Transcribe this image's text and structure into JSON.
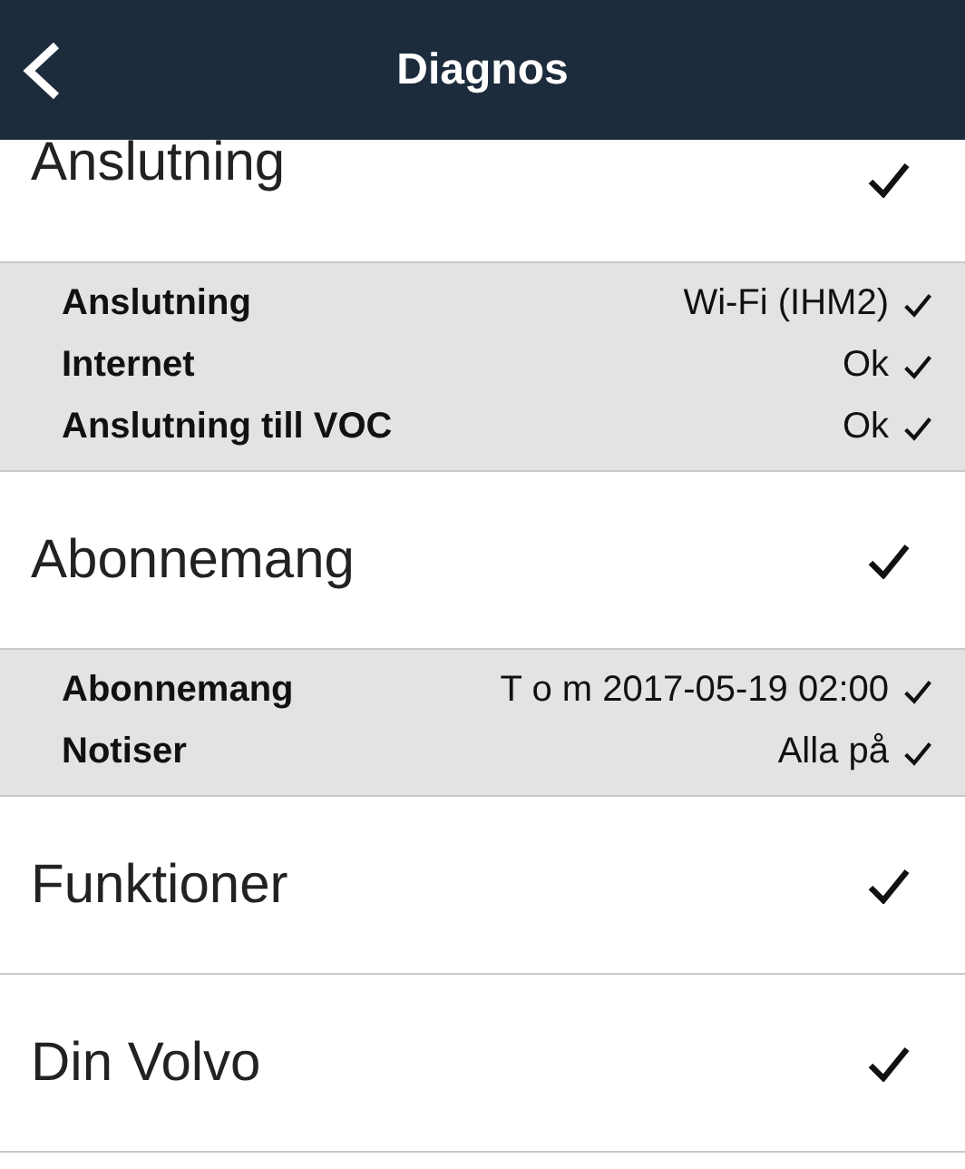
{
  "header": {
    "title": "Diagnos"
  },
  "sections": [
    {
      "title": "Anslutning",
      "checked": true,
      "details": [
        {
          "label": "Anslutning",
          "value": "Wi-Fi (IHM2)",
          "checked": true
        },
        {
          "label": "Internet",
          "value": "Ok",
          "checked": true
        },
        {
          "label": "Anslutning till VOC",
          "value": "Ok",
          "checked": true
        }
      ]
    },
    {
      "title": "Abonnemang",
      "checked": true,
      "details": [
        {
          "label": "Abonnemang",
          "value": "T o m 2017-05-19 02:00",
          "checked": true
        },
        {
          "label": "Notiser",
          "value": "Alla på",
          "checked": true
        }
      ]
    },
    {
      "title": "Funktioner",
      "checked": true
    },
    {
      "title": "Din Volvo",
      "checked": true
    }
  ]
}
